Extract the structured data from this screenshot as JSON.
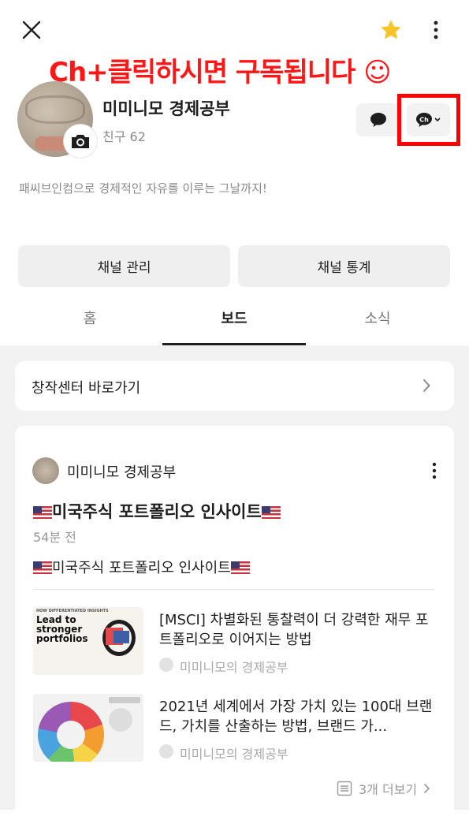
{
  "header": {
    "close_icon": "close-icon",
    "star_icon": "star-icon",
    "more_icon": "more-vertical-icon",
    "promo_text": "Ch+클릭하시면 구독됩니다 ☺"
  },
  "profile": {
    "name": "미미니모 경제공부",
    "friends": "친구 62",
    "description": "패씨브인컴으로 경제적인 자유를 이루는 그날까지!",
    "chat_icon": "chat-bubble-icon",
    "channel_icon_label": "Ch"
  },
  "actions": {
    "manage": "채널 관리",
    "stats": "채널 통계"
  },
  "tabs": [
    {
      "label": "홈",
      "active": false
    },
    {
      "label": "보드",
      "active": true
    },
    {
      "label": "소식",
      "active": false
    }
  ],
  "creator_center": {
    "label": "창작센터 바로가기"
  },
  "post": {
    "author": "미미니모 경제공부",
    "title": "미국주식 포트폴리오 인사이트",
    "time": "54분 전",
    "body": "미국주식 포트폴리오 인사이트",
    "items": [
      {
        "title": "[MSCI] 차별화된 통찰력이 더 강력한 재무 포트폴리오로 이어지는 방법",
        "source": "미미니모의 경제공부",
        "thumb_kicker": "HOW DIFFERENTIATED INSIGHTS",
        "thumb_headline": "Lead to stronger portfolios"
      },
      {
        "title": "2021년 세계에서 가장 가치 있는 100대 브랜드, 가치를 산출하는 방법, 브랜드 가...",
        "source": "미미니모의 경제공부"
      }
    ],
    "more": "3개 더보기"
  },
  "colors": {
    "promo": "#ff1616",
    "star": "#f7c52a",
    "highlight_box": "#ff0000"
  }
}
